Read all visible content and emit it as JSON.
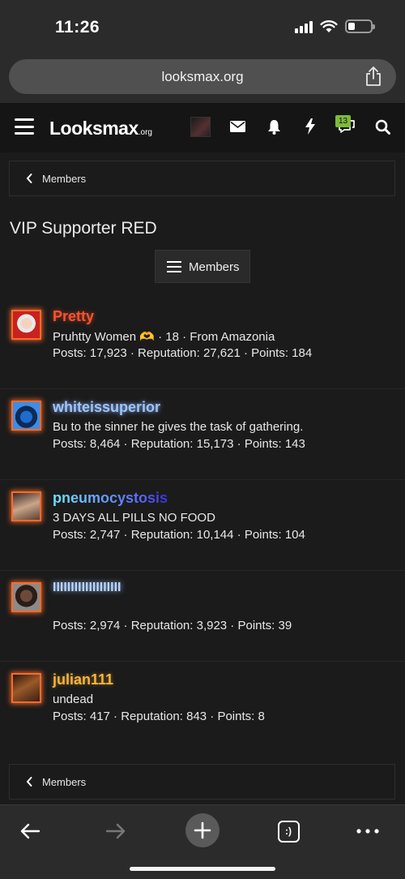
{
  "status_bar": {
    "time": "11:26"
  },
  "browser": {
    "url": "looksmax.org",
    "tabs_label": ":)"
  },
  "site": {
    "logo_main": "Looksmax",
    "logo_suffix": ".org",
    "conversations_badge": "13"
  },
  "breadcrumb": {
    "label": "Members"
  },
  "page": {
    "title": "VIP Supporter RED",
    "members_button": "Members"
  },
  "members": [
    {
      "name": "Pretty",
      "line2": "Pruhtty Women 🫶 · 18 · From Amazonia",
      "stats": "Posts: 17,923 · Reputation: 27,621 · Points: 184"
    },
    {
      "name": "whiteissuperior",
      "line2": "Bu to the sinner he gives the task of gathering.",
      "stats": "Posts: 8,464 · Reputation: 15,173 · Points: 143"
    },
    {
      "name": "pneumocystosis",
      "line2": "3 DAYS ALL PILLS NO FOOD",
      "stats": "Posts: 2,747 · Reputation: 10,144 · Points: 104"
    },
    {
      "name": "IIIIIIIIIIIIIIIIIII",
      "line2": "",
      "stats": "Posts: 2,974 · Reputation: 3,923 · Points: 39"
    },
    {
      "name": "julian111",
      "line2": "undead",
      "stats": "Posts: 417 · Reputation: 843 · Points: 8"
    }
  ],
  "colors": {
    "accent_glow": "#ff6a2a",
    "background": "#1b1b1b",
    "badge": "#7dbb3a"
  },
  "icons": [
    "hamburger-icon",
    "mail-icon",
    "bell-icon",
    "lightning-icon",
    "conversations-icon",
    "search-icon",
    "share-icon",
    "back-arrow-icon",
    "forward-arrow-icon",
    "plus-icon",
    "tabs-icon",
    "more-icon"
  ]
}
